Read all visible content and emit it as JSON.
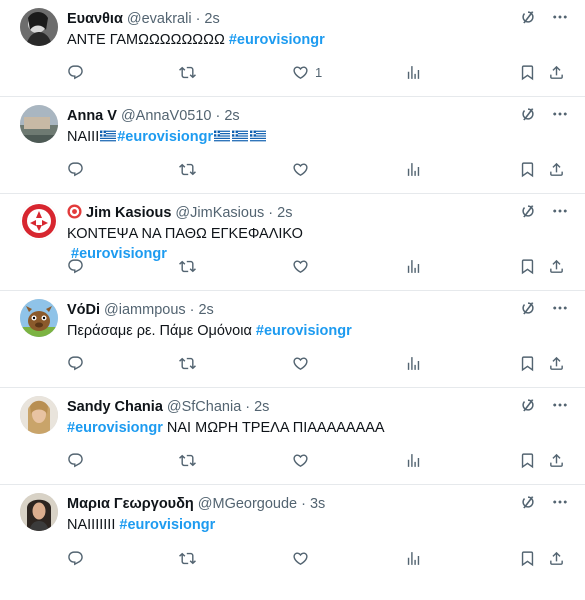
{
  "tweets": [
    {
      "name": "Ευανθια",
      "handle": "@evakrali",
      "time": "2s",
      "text": "ΑΝΤΕ ΓΑΜΩΩΩΩΩΩΩΩ ",
      "hashtag": "#eurovisiongr",
      "likes": "1",
      "avatar": "woman-bw-photo"
    },
    {
      "name": "Anna V",
      "handle": "@AnnaV0510",
      "time": "2s",
      "text": "ΝΑΙΙΙ",
      "hashtag": "#eurovisiongr",
      "likes": "",
      "avatar": "landscape-photo"
    },
    {
      "name": "Jim Kasious",
      "handle": "@JimKasious",
      "time": "2s",
      "text": "ΚΟΝΤΕΨΑ ΝΑ ΠΑΘΩ ΕΓΚΕΦΑΛΙΚΟ",
      "hashtag": "#eurovisiongr",
      "likes": "",
      "avatar": "olympiacos-logo"
    },
    {
      "name": "VόDi",
      "handle": "@iammpous",
      "time": "2s",
      "text": "Περάσαμε ρε. Πάμε Ομόνοια ",
      "hashtag": "#eurovisiongr",
      "likes": "",
      "avatar": "cartoon-animal"
    },
    {
      "name": "Sandy Chania",
      "handle": "@SfChania",
      "time": "2s",
      "text": " ΝΑΙ ΜΩΡΗ ΤΡΕΛΑ ΠΙΑΑΑΑΑΑΑΑ",
      "hashtag": "#eurovisiongr",
      "likes": "",
      "avatar": "woman-blonde-photo"
    },
    {
      "name": "Μαρια Γεωργουδη",
      "handle": "@MGeorgoude",
      "time": "3s",
      "text": "ΝΑΙΙΙΙΙΙΙ ",
      "hashtag": "#eurovisiongr",
      "likes": "",
      "avatar": "woman-dark-photo"
    }
  ],
  "icons": {
    "reply": "reply-icon",
    "retweet": "retweet-icon",
    "like": "heart-icon",
    "views": "views-icon",
    "bookmark": "bookmark-icon",
    "share": "share-icon",
    "grok": "grok-icon",
    "more": "more-icon"
  },
  "colors": {
    "hashtag": "#1d9bf0",
    "muted": "#536471",
    "text": "#0f1419"
  }
}
